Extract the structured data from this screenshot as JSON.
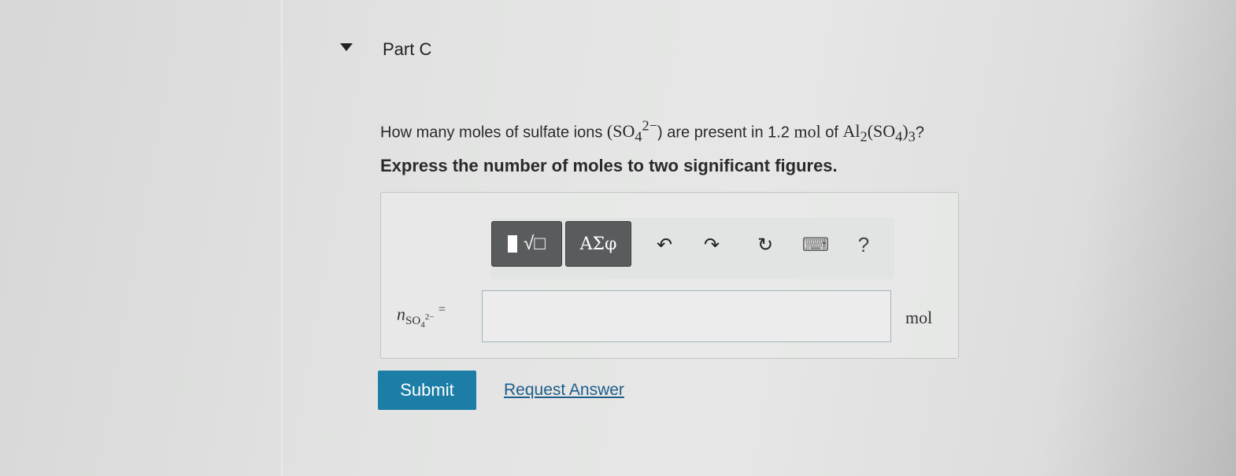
{
  "part": {
    "title": "Part C"
  },
  "question": {
    "prefix": "How many moles of sulfate ions ",
    "ion_open": "(SO",
    "ion_sub": "4",
    "ion_sup": "2−",
    "ion_close": ")",
    "middle": " are present in 1.2 ",
    "amount_unit": "mol",
    "of_text": " of ",
    "compound_al": "Al",
    "compound_al_sub": "2",
    "compound_so": "(SO",
    "compound_so_sub": "4",
    "compound_close": ")",
    "compound_close_sub": "3",
    "suffix": "?"
  },
  "instruction": "Express the number of moles to two significant figures.",
  "toolbar": {
    "templates_label": "√□",
    "symbols_label": "ΑΣφ",
    "help_label": "?",
    "undo_glyph": "↶",
    "redo_glyph": "↷",
    "reset_glyph": "↻",
    "keyboard_glyph": "⌨"
  },
  "answer": {
    "var_n": "n",
    "var_sub": "SO",
    "var_sub_sub": "4",
    "var_sup": "2−",
    "equals": "=",
    "value": "",
    "unit": "mol"
  },
  "actions": {
    "submit_label": "Submit",
    "request_label": "Request Answer"
  },
  "colors": {
    "submit_bg": "#1c7ea6",
    "link": "#1f5d8a",
    "toolbar_button": "#595c5d"
  }
}
